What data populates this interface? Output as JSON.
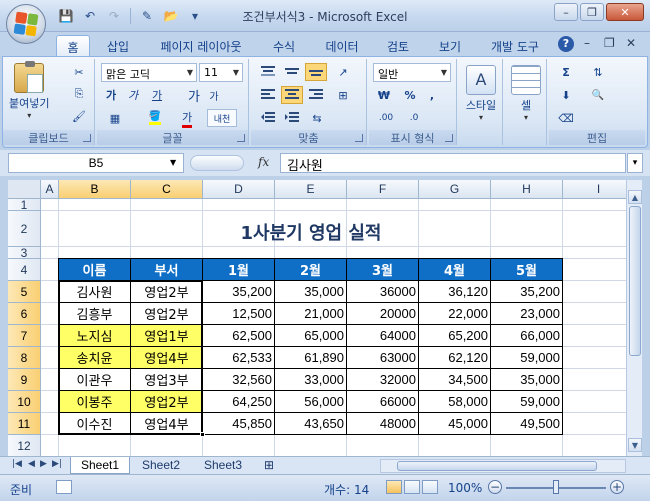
{
  "window": {
    "title": "조건부서식3 - Microsoft Excel"
  },
  "qat": {
    "save_icon": "💾",
    "undo_icon": "↶",
    "redo_icon": "↷",
    "new_icon": "✎",
    "open_icon": "📂",
    "customize_icon": "▾"
  },
  "window_controls": {
    "minimize": "–",
    "restore": "❐",
    "close": "✕"
  },
  "ribbon_tabs": [
    "홈",
    "삽입",
    "페이지 레이아웃",
    "수식",
    "데이터",
    "검토",
    "보기",
    "개발 도구"
  ],
  "ribbon_tab_active": "홈",
  "ribbon_minis": {
    "help": "?",
    "minimize": "–",
    "restore": "❐",
    "close": "✕"
  },
  "ribbon": {
    "clipboard": {
      "label": "클립보드",
      "paste": "붙여넣기",
      "cut_icon": "✂",
      "copy_icon": "⎘",
      "painter_icon": "🖌"
    },
    "font": {
      "label": "글꼴",
      "font_name": "맑은 고딕",
      "font_size": "11",
      "bold": "가",
      "italic": "가",
      "underline": "가",
      "grow": "가",
      "shrink": "가",
      "border_icon": "▦",
      "fill_icon": "🪣",
      "font_color": "가",
      "phonetic": "내천"
    },
    "alignment": {
      "label": "맞춤",
      "wrap_icon": "⇆",
      "merge_icon": "⊞",
      "orient_icon": "↗"
    },
    "number": {
      "label": "표시 형식",
      "format": "일반",
      "currency": "₩",
      "percent": "%",
      "comma": ",",
      "inc_decimal": ".00",
      "dec_decimal": ".0"
    },
    "styles": {
      "label": "",
      "button": "스타일"
    },
    "cells": {
      "label": "",
      "button": "셀"
    },
    "editing": {
      "label": "편집",
      "sum_icon": "Σ",
      "sort_icon": "⇅",
      "fill_icon": "⬇",
      "find_icon": "🔍",
      "clear_icon": "⌫"
    }
  },
  "formula_bar": {
    "name_box": "B5",
    "fx": "fx",
    "content": "김사원",
    "expand": "▾"
  },
  "columns": [
    "A",
    "B",
    "C",
    "D",
    "E",
    "F",
    "G",
    "H",
    "I"
  ],
  "selected_column_labels": [
    "B",
    "C"
  ],
  "rows": [
    "1",
    "2",
    "3",
    "4",
    "5",
    "6",
    "7",
    "8",
    "9",
    "10",
    "11",
    "12"
  ],
  "selected_row_labels": [
    "5",
    "6",
    "7",
    "8",
    "9",
    "10",
    "11"
  ],
  "sheet": {
    "title": "1사분기 영업 실적",
    "headers": [
      "이름",
      "부서",
      "1월",
      "2월",
      "3월",
      "4월",
      "5월"
    ],
    "records": [
      {
        "name": "김사원",
        "dept": "영업2부",
        "m1": "35,200",
        "m2": "35,000",
        "m3": "36000",
        "m4": "36,120",
        "m5": "35,200",
        "highlight": false
      },
      {
        "name": "김흥부",
        "dept": "영업2부",
        "m1": "12,500",
        "m2": "21,000",
        "m3": "20000",
        "m4": "22,000",
        "m5": "23,000",
        "highlight": false
      },
      {
        "name": "노지심",
        "dept": "영업1부",
        "m1": "62,500",
        "m2": "65,000",
        "m3": "64000",
        "m4": "65,200",
        "m5": "66,000",
        "highlight": true
      },
      {
        "name": "송치윤",
        "dept": "영업4부",
        "m1": "62,533",
        "m2": "61,890",
        "m3": "63000",
        "m4": "62,120",
        "m5": "59,000",
        "highlight": true
      },
      {
        "name": "이관우",
        "dept": "영업3부",
        "m1": "32,560",
        "m2": "33,000",
        "m3": "32000",
        "m4": "34,500",
        "m5": "35,000",
        "highlight": false
      },
      {
        "name": "이봉주",
        "dept": "영업2부",
        "m1": "64,250",
        "m2": "56,000",
        "m3": "66000",
        "m4": "58,000",
        "m5": "59,000",
        "highlight": true
      },
      {
        "name": "이수진",
        "dept": "영업4부",
        "m1": "45,850",
        "m2": "43,650",
        "m3": "48000",
        "m4": "45,000",
        "m5": "49,500",
        "highlight": false
      }
    ]
  },
  "colors": {
    "header_fill": "#0f6fc6",
    "highlight_fill": "#ffff66",
    "title_text": "#1f3864"
  },
  "sheet_tabs": [
    "Sheet1",
    "Sheet2",
    "Sheet3"
  ],
  "active_sheet": "Sheet1",
  "status_bar": {
    "mode": "준비",
    "count": "개수: 14",
    "zoom": "100%",
    "zoom_level_percent": 100
  }
}
